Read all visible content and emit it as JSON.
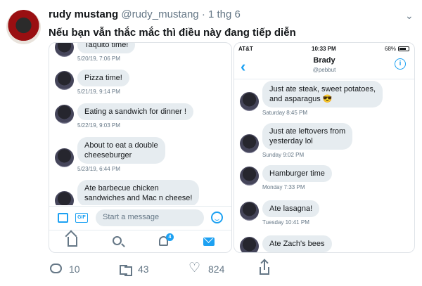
{
  "tweet": {
    "author_name": "rudy mustang",
    "handle": "@rudy_mustang",
    "separator": "·",
    "time": "1 thg 6",
    "text": "Nếu bạn vẫn thắc mắc thì điều này đang tiếp diễn",
    "menu_icon": "chevron-down-icon"
  },
  "left_shot": {
    "messages": [
      {
        "text": "Taquito time!",
        "time": "5/20/19, 7:06 PM"
      },
      {
        "text": "Pizza time!",
        "time": "5/21/19, 9:14 PM"
      },
      {
        "text": "Eating a sandwich for dinner !",
        "time": "5/22/19, 9:03 PM"
      },
      {
        "text": "About to eat a double\ncheeseburger",
        "time": "5/23/19, 6:44 PM"
      },
      {
        "text": "Ate barbecue chicken\nsandwiches and Mac n cheese!",
        "time": ""
      }
    ],
    "composer": {
      "gif_label": "GIF",
      "placeholder": "Start a message"
    },
    "tabbar": {
      "notifications_badge": "4"
    }
  },
  "right_shot": {
    "status": {
      "carrier": "AT&T",
      "time": "10:33 PM",
      "battery": "68%"
    },
    "header": {
      "name": "Brady",
      "handle": "@pebbut",
      "back_icon": "‹",
      "info_icon": "i"
    },
    "messages": [
      {
        "text": "Just ate steak, sweet potatoes,\nand asparagus 😎",
        "time": "Saturday 8:45 PM"
      },
      {
        "text": "Just ate leftovers from\nyesterday lol",
        "time": "Sunday 9:02 PM"
      },
      {
        "text": "Hamburger time",
        "time": "Monday 7:33 PM"
      },
      {
        "text": "Ate lasagna!",
        "time": "Tuesday 10:41 PM"
      },
      {
        "text": "Ate Zach's bees",
        "time": ""
      }
    ]
  },
  "actions": {
    "replies": "10",
    "retweets": "43",
    "likes": "824",
    "like_icon": "♡"
  },
  "colors": {
    "accent": "#1da1f2",
    "muted": "#657786",
    "bubble": "#e6ecf0"
  }
}
